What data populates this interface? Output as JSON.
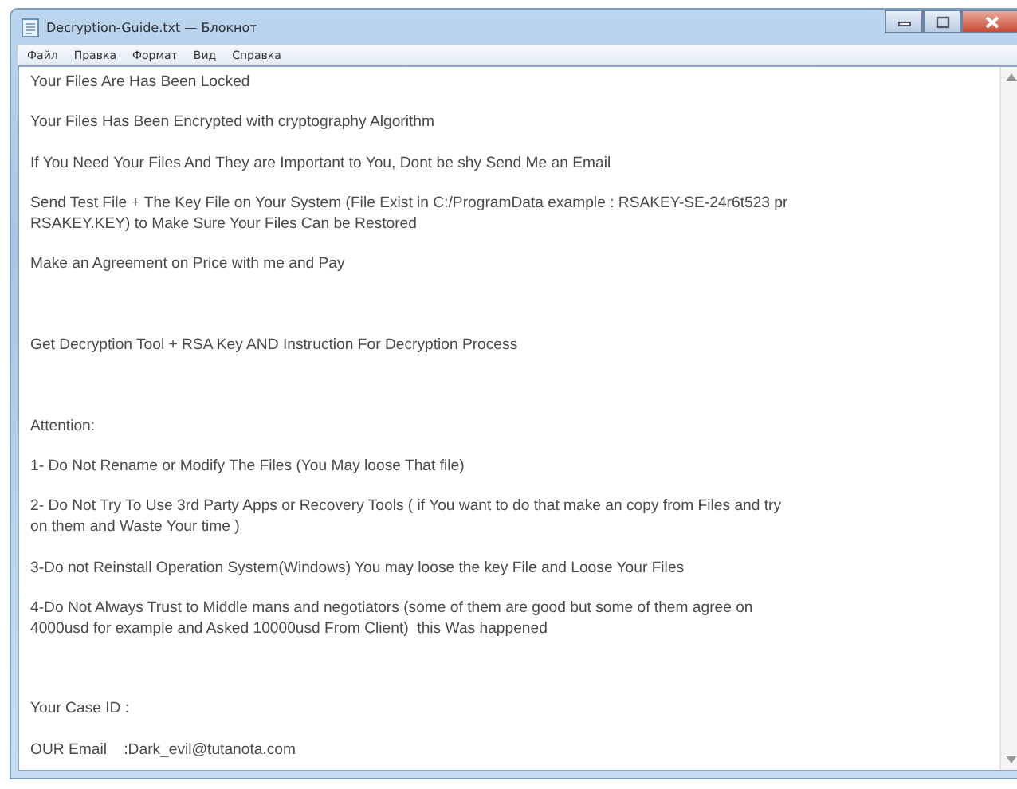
{
  "window": {
    "title": "Decryption-Guide.txt — Блокнот"
  },
  "menu": [
    "Файл",
    "Правка",
    "Формат",
    "Вид",
    "Справка"
  ],
  "document": {
    "lines": [
      {
        "kind": "text",
        "text": "Your Files Are Has Been Locked"
      },
      {
        "kind": "blank"
      },
      {
        "kind": "text",
        "text": "Your Files Has Been Encrypted with cryptography Algorithm"
      },
      {
        "kind": "blank"
      },
      {
        "kind": "text",
        "text": "If You Need Your Files And They are Important to You, Dont be shy Send Me an Email"
      },
      {
        "kind": "blank"
      },
      {
        "kind": "text",
        "text": "Send Test File + The Key File on Your System (File Exist in C:/ProgramData example : RSAKEY-SE-24r6t523 pr"
      },
      {
        "kind": "text",
        "text": "RSAKEY.KEY) to Make Sure Your Files Can be Restored"
      },
      {
        "kind": "blank"
      },
      {
        "kind": "text",
        "text": "Make an Agreement on Price with me and Pay"
      },
      {
        "kind": "blank"
      },
      {
        "kind": "blank"
      },
      {
        "kind": "blank"
      },
      {
        "kind": "text",
        "text": "Get Decryption Tool + RSA Key AND Instruction For Decryption Process"
      },
      {
        "kind": "blank"
      },
      {
        "kind": "blank"
      },
      {
        "kind": "blank"
      },
      {
        "kind": "text",
        "text": "Attention:"
      },
      {
        "kind": "blank"
      },
      {
        "kind": "text",
        "text": "1- Do Not Rename or Modify The Files (You May loose That file)"
      },
      {
        "kind": "blank"
      },
      {
        "kind": "text",
        "text": "2- Do Not Try To Use 3rd Party Apps or Recovery Tools ( if You want to do that make an copy from Files and try"
      },
      {
        "kind": "text",
        "text": "on them and Waste Your time )"
      },
      {
        "kind": "blank"
      },
      {
        "kind": "text",
        "text": "3-Do not Reinstall Operation System(Windows) You may loose the key File and Loose Your Files"
      },
      {
        "kind": "blank"
      },
      {
        "kind": "text",
        "text": "4-Do Not Always Trust to Middle mans and negotiators (some of them are good but some of them agree on"
      },
      {
        "kind": "text",
        "text": "4000usd for example and Asked 10000usd From Client)  this Was happened"
      },
      {
        "kind": "blank"
      },
      {
        "kind": "blank"
      },
      {
        "kind": "blank"
      },
      {
        "kind": "text",
        "text": "Your Case ID :"
      },
      {
        "kind": "blank"
      },
      {
        "kind": "text",
        "text": "OUR Email    :Dark_evil@tutanota.com"
      }
    ]
  }
}
